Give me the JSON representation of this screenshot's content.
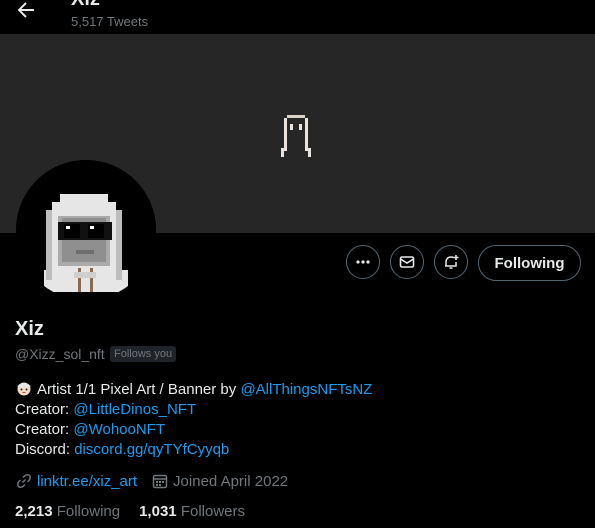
{
  "header": {
    "title": "Xiz",
    "tweet_count": "5,517 Tweets",
    "back_icon": "arrow-left-icon"
  },
  "profile": {
    "name": "Xiz",
    "handle": "@Xizz_sol_nft",
    "follows_you_badge": "Follows you",
    "actions": {
      "more_icon": "ellipsis-icon",
      "message_icon": "envelope-icon",
      "notify_icon": "bell-plus-icon",
      "follow_label": "Following"
    },
    "bio": {
      "line1_text": "Artist 1/1 Pixel Art / Banner by",
      "line1_mention": "@AllThingsNFTsNZ",
      "line2_label": "Creator:",
      "line2_mention": "@LittleDinos_NFT",
      "line3_label": "Creator:",
      "line3_mention": "@WohooNFT",
      "line4_label": "Discord:",
      "line4_link": "discord.gg/qyTYfCyyqb"
    },
    "website": "linktr.ee/xiz_art",
    "joined": "Joined April 2022",
    "following_count": "2,213",
    "following_label": "Following",
    "followers_count": "1,031",
    "followers_label": "Followers"
  },
  "colors": {
    "background": "#000000",
    "banner": "#262626",
    "link": "#1d9bf0",
    "muted": "#71767b"
  }
}
